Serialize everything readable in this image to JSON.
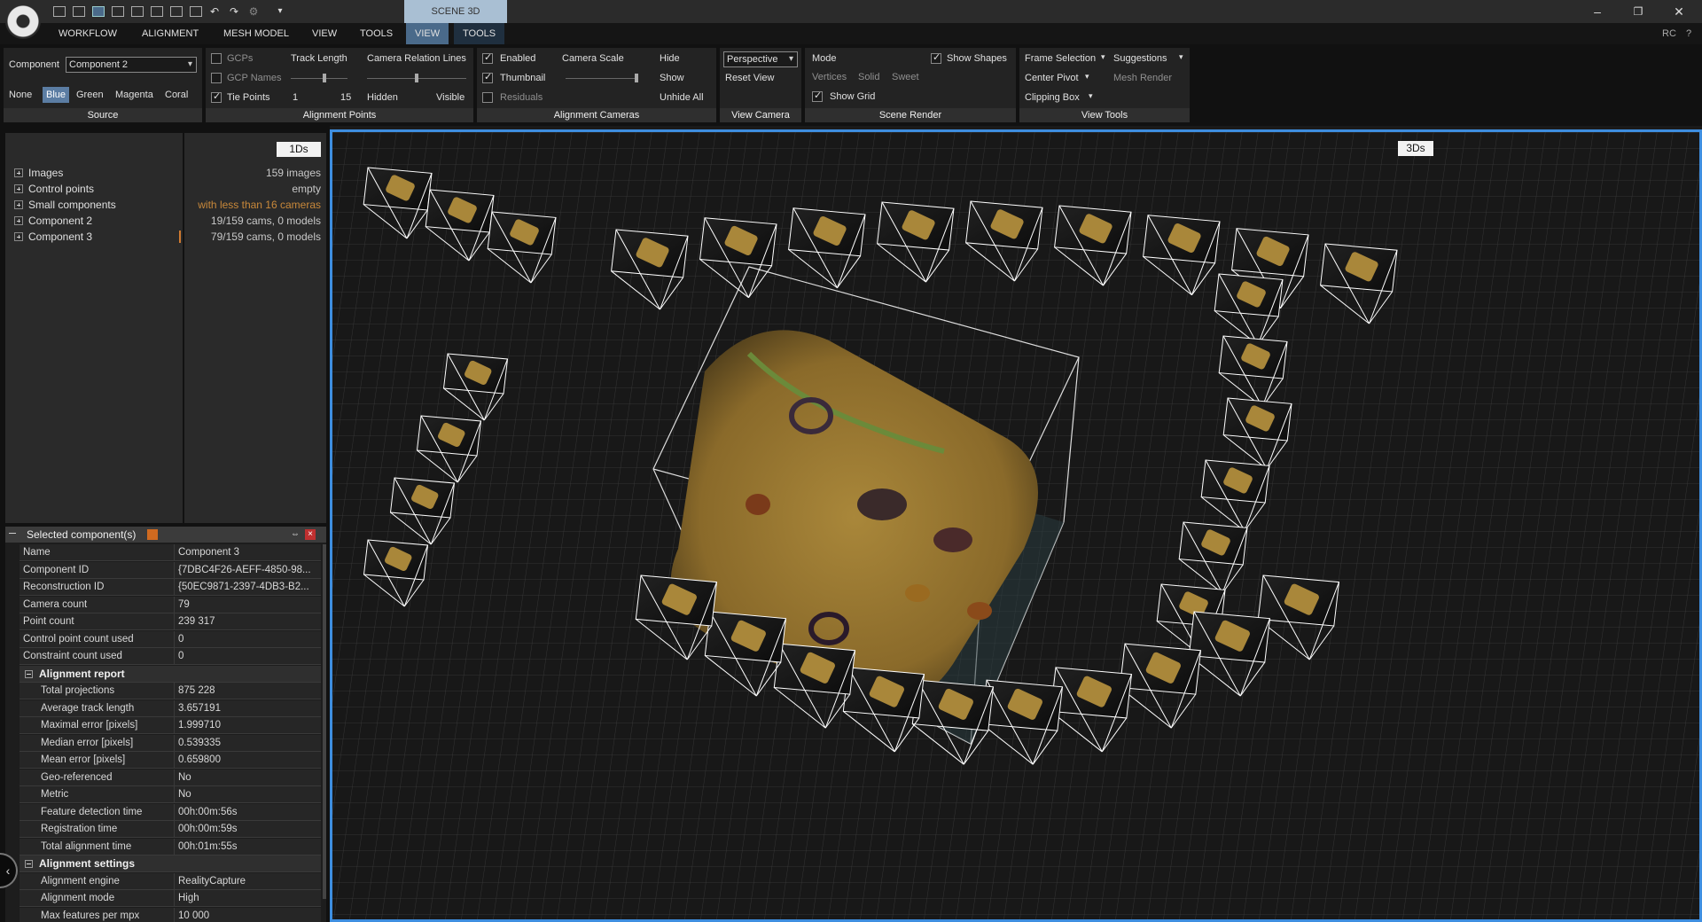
{
  "titlebar": {
    "scene_tab": "SCENE 3D",
    "minimize": "–",
    "maximize": "❐",
    "close": "✕"
  },
  "menubar": {
    "items": [
      "WORKFLOW",
      "ALIGNMENT",
      "MESH MODEL",
      "VIEW",
      "TOOLS",
      "VIEW",
      "TOOLS"
    ],
    "user": "RC",
    "help": "?"
  },
  "ribbon": {
    "source": {
      "component_label": "Component",
      "component_value": "Component 2",
      "colors": [
        "None",
        "Blue",
        "Green",
        "Magenta",
        "Coral"
      ],
      "group": "Source"
    },
    "alignment_points": {
      "gcps": "GCPs",
      "gcp_names": "GCP Names",
      "tie_points": "Tie Points",
      "track_length": "Track Length",
      "track_min": "1",
      "track_max": "15",
      "camera_relation_lines": "Camera Relation Lines",
      "hidden": "Hidden",
      "visible": "Visible",
      "group": "Alignment Points"
    },
    "alignment_cameras": {
      "enabled": "Enabled",
      "thumbnail": "Thumbnail",
      "residuals": "Residuals",
      "camera_scale": "Camera Scale",
      "hide": "Hide",
      "show": "Show",
      "unhide_all": "Unhide All",
      "group": "Alignment Cameras"
    },
    "view_camera": {
      "projection": "Perspective",
      "reset_view": "Reset View",
      "group": "View Camera"
    },
    "scene_render": {
      "mode": "Mode",
      "vertices": "Vertices",
      "solid": "Solid",
      "sweet": "Sweet",
      "show_grid": "Show Grid",
      "show_shapes": "Show Shapes",
      "group": "Scene Render"
    },
    "view_tools": {
      "frame_selection": "Frame Selection",
      "suggestions": "Suggestions",
      "center_pivot": "Center Pivot",
      "mesh_render": "Mesh Render",
      "clipping_box": "Clipping Box",
      "group": "View Tools"
    }
  },
  "tree": {
    "tag": "1Ds",
    "items": [
      {
        "label": "Images",
        "value": "159 images"
      },
      {
        "label": "Control points",
        "value": "empty"
      },
      {
        "label": "Small components",
        "value": "with less than 16 cameras"
      },
      {
        "label": "Component 2",
        "value": "19/159 cams, 0 models"
      },
      {
        "label": "Component 3",
        "value": "79/159 cams, 0 models"
      }
    ]
  },
  "properties": {
    "title": "Selected component(s)",
    "rows": [
      {
        "k": "Name",
        "v": "Component 3"
      },
      {
        "k": "Component ID",
        "v": "{7DBC4F26-AEFF-4850-98..."
      },
      {
        "k": "Reconstruction ID",
        "v": "{50EC9871-2397-4DB3-B2..."
      },
      {
        "k": "Camera count",
        "v": "79"
      },
      {
        "k": "Point count",
        "v": "239 317"
      },
      {
        "k": "Control point count used",
        "v": "0"
      },
      {
        "k": "Constraint count used",
        "v": "0"
      }
    ],
    "alignment_report": {
      "title": "Alignment report",
      "rows": [
        {
          "k": "Total projections",
          "v": "875 228"
        },
        {
          "k": "Average track length",
          "v": "3.657191"
        },
        {
          "k": "Maximal error [pixels]",
          "v": "1.999710"
        },
        {
          "k": "Median error [pixels]",
          "v": "0.539335"
        },
        {
          "k": "Mean error [pixels]",
          "v": "0.659800"
        },
        {
          "k": "Geo-referenced",
          "v": "No"
        },
        {
          "k": "Metric",
          "v": "No"
        },
        {
          "k": "Feature detection time",
          "v": "00h:00m:56s"
        },
        {
          "k": "Registration time",
          "v": "00h:00m:59s"
        },
        {
          "k": "Total alignment time",
          "v": "00h:01m:55s"
        }
      ]
    },
    "alignment_settings": {
      "title": "Alignment settings",
      "rows": [
        {
          "k": "Alignment engine",
          "v": "RealityCapture"
        },
        {
          "k": "Alignment mode",
          "v": "High"
        },
        {
          "k": "Max features per mpx",
          "v": "10 000"
        }
      ]
    }
  },
  "viewport": {
    "tag": "3Ds",
    "grid_color": "#3a3a3a",
    "frustum_color": "#ffffff",
    "selection_color": "#3e8ee0"
  }
}
